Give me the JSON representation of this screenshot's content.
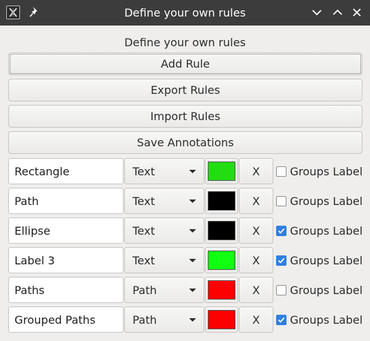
{
  "window": {
    "title": "Define your own rules"
  },
  "heading": "Define your own rules",
  "buttons": {
    "add_rule": "Add Rule",
    "export_rules": "Export Rules",
    "import_rules": "Import Rules",
    "save_annotations": "Save Annotations"
  },
  "rules": [
    {
      "name": "Rectangle",
      "type": "Text",
      "color": "#22dd11",
      "remove": "X",
      "groups_label": "Groups Label",
      "checked": false
    },
    {
      "name": "Path",
      "type": "Text",
      "color": "#000000",
      "remove": "X",
      "groups_label": "Groups Label",
      "checked": false
    },
    {
      "name": "Ellipse",
      "type": "Text",
      "color": "#000000",
      "remove": "X",
      "groups_label": "Groups Label",
      "checked": true
    },
    {
      "name": "Label 3",
      "type": "Text",
      "color": "#11ff11",
      "remove": "X",
      "groups_label": "Groups Label",
      "checked": true
    },
    {
      "name": "Paths",
      "type": "Path",
      "color": "#ff0000",
      "remove": "X",
      "groups_label": "Groups Label",
      "checked": false
    },
    {
      "name": "Grouped Paths",
      "type": "Path",
      "color": "#ff0000",
      "remove": "X",
      "groups_label": "Groups Label",
      "checked": true
    }
  ],
  "icons": {
    "app": "app-x-icon",
    "pin": "pin-icon",
    "minimize": "chevron-down-icon",
    "maximize": "chevron-up-icon",
    "close": "close-icon",
    "dropdown": "caret-down-icon",
    "check": "checkmark-icon"
  }
}
